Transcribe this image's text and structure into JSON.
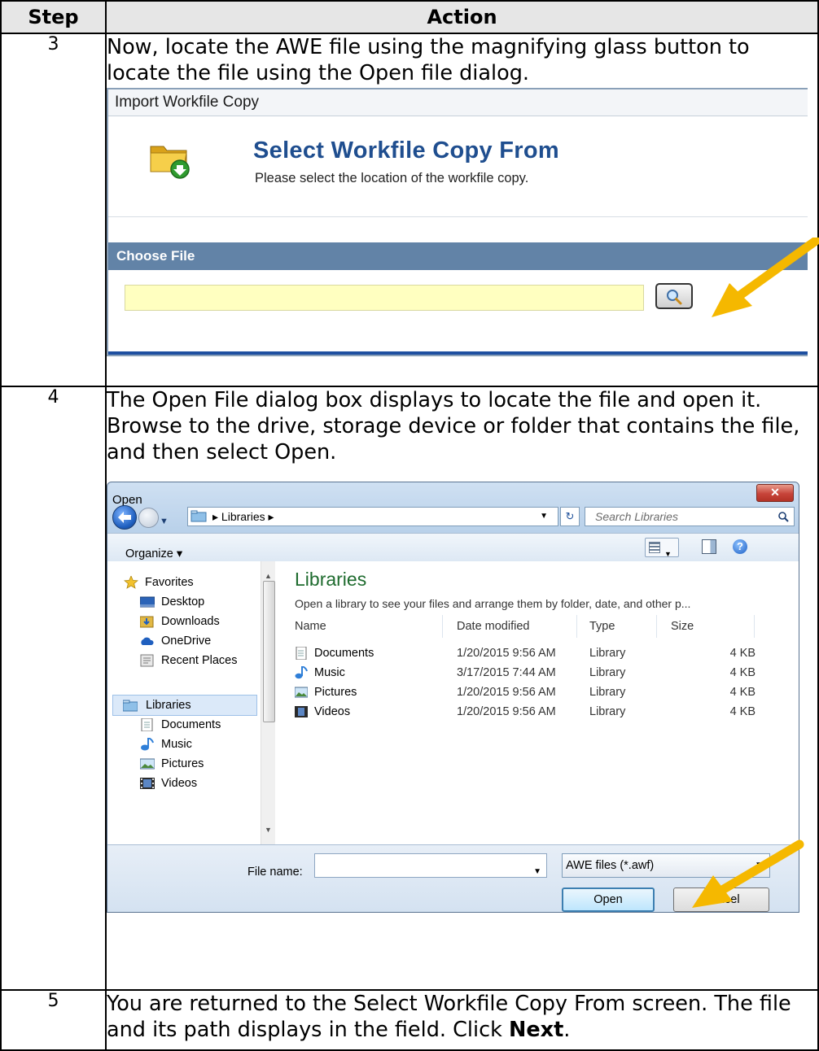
{
  "table": {
    "header_step": "Step",
    "header_action": "Action",
    "rows": [
      {
        "step": "3",
        "text": "Now, locate the AWE file using the magnifying glass button to locate the file using the Open file dialog."
      },
      {
        "step": "4",
        "text": "The Open File dialog box displays to locate the file and open it.  Browse to the drive, storage device or folder that contains the file, and then select Open."
      },
      {
        "step": "5",
        "text_before": "You are returned to the Select Workfile Copy From screen. The file and its path displays in the field. Click ",
        "text_bold": "Next",
        "text_after": "."
      }
    ]
  },
  "import_panel": {
    "title": "Import Workfile Copy",
    "heading": "Select Workfile Copy From",
    "subtitle": "Please select the location of the workfile copy.",
    "section_label": "Choose File",
    "file_value": "",
    "icons": {
      "folder": "folder-download-icon",
      "search": "magnifier-icon"
    },
    "colors": {
      "heading": "#1f4e8f",
      "section_bar": "#6283a7",
      "input_bg": "#ffffc0",
      "arrow": "#f5b800"
    }
  },
  "open_dialog": {
    "title": "Open",
    "close_label": "✕",
    "address_crumb": "Libraries",
    "search_placeholder": "Search Libraries",
    "organize_label": "Organize ▾",
    "help_label": "?",
    "nav": {
      "favorites": "Favorites",
      "favorites_items": [
        "Desktop",
        "Downloads",
        "OneDrive",
        "Recent Places"
      ],
      "libraries": "Libraries",
      "libraries_items": [
        "Documents",
        "Music",
        "Pictures",
        "Videos"
      ]
    },
    "content_title": "Libraries",
    "content_desc": "Open a library to see your files and arrange them by folder, date, and other p...",
    "columns": [
      "Name",
      "Date modified",
      "Type",
      "Size"
    ],
    "files": [
      {
        "name": "Documents",
        "date": "1/20/2015 9:56 AM",
        "type": "Library",
        "size": "4 KB"
      },
      {
        "name": "Music",
        "date": "3/17/2015 7:44 AM",
        "type": "Library",
        "size": "4 KB"
      },
      {
        "name": "Pictures",
        "date": "1/20/2015 9:56 AM",
        "type": "Library",
        "size": "4 KB"
      },
      {
        "name": "Videos",
        "date": "1/20/2015 9:56 AM",
        "type": "Library",
        "size": "4 KB"
      }
    ],
    "file_name_label": "File name:",
    "file_name_value": "",
    "filter_label": "AWE files (*.awf)",
    "open_label": "Open",
    "cancel_label": "Cancel"
  }
}
